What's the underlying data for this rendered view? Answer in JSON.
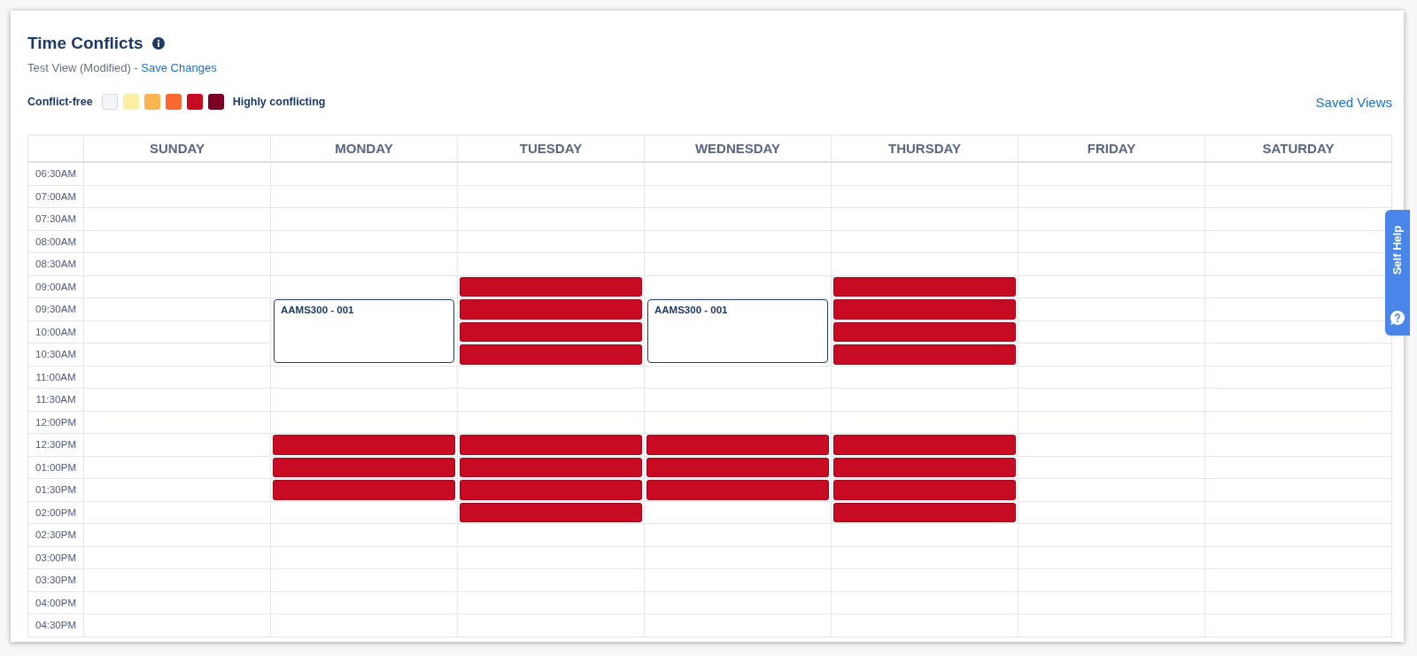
{
  "header": {
    "title": "Time Conflicts",
    "subtitle": "Test View (Modified) - ",
    "save_link": "Save Changes"
  },
  "legend": {
    "low_label": "Conflict-free",
    "high_label": "Highly conflicting",
    "swatches": [
      {
        "color": "#f3f5f9"
      },
      {
        "color": "#fdeea6"
      },
      {
        "color": "#fbb34f"
      },
      {
        "color": "#fa6731"
      },
      {
        "color": "#c80a23"
      },
      {
        "color": "#7b0025"
      }
    ]
  },
  "saved_views": "Saved Views",
  "self_help": "Self Help",
  "calendar": {
    "times": [
      "06:30AM",
      "07:00AM",
      "07:30AM",
      "08:00AM",
      "08:30AM",
      "09:00AM",
      "09:30AM",
      "10:00AM",
      "10:30AM",
      "11:00AM",
      "11:30AM",
      "12:00PM",
      "12:30PM",
      "01:00PM",
      "01:30PM",
      "02:00PM",
      "02:30PM",
      "03:00PM",
      "03:30PM",
      "04:00PM",
      "04:30PM"
    ],
    "days": [
      {
        "name": "SUNDAY",
        "slots": [
          {
            "kind": "empty"
          },
          {
            "kind": "empty"
          },
          {
            "kind": "empty"
          },
          {
            "kind": "empty"
          },
          {
            "kind": "empty"
          },
          {
            "kind": "empty"
          },
          {
            "kind": "empty"
          },
          {
            "kind": "empty"
          },
          {
            "kind": "empty"
          },
          {
            "kind": "empty"
          },
          {
            "kind": "empty"
          },
          {
            "kind": "empty"
          },
          {
            "kind": "empty"
          },
          {
            "kind": "empty"
          },
          {
            "kind": "empty"
          },
          {
            "kind": "empty"
          },
          {
            "kind": "empty"
          },
          {
            "kind": "empty"
          },
          {
            "kind": "empty"
          },
          {
            "kind": "empty"
          },
          {
            "kind": "empty"
          }
        ]
      },
      {
        "name": "MONDAY",
        "slots": [
          {
            "kind": "empty"
          },
          {
            "kind": "empty"
          },
          {
            "kind": "empty"
          },
          {
            "kind": "empty"
          },
          {
            "kind": "empty"
          },
          {
            "kind": "empty"
          },
          {
            "kind": "course",
            "label": "AAMS300 - 001"
          },
          {
            "kind": "course-cont"
          },
          {
            "kind": "course-cont"
          },
          {
            "kind": "empty"
          },
          {
            "kind": "empty"
          },
          {
            "kind": "empty"
          },
          {
            "kind": "conflict",
            "color": "#c80a23"
          },
          {
            "kind": "conflict",
            "color": "#c80a23"
          },
          {
            "kind": "conflict",
            "color": "#c80a23"
          },
          {
            "kind": "empty"
          },
          {
            "kind": "empty"
          },
          {
            "kind": "empty"
          },
          {
            "kind": "empty"
          },
          {
            "kind": "empty"
          },
          {
            "kind": "empty"
          }
        ]
      },
      {
        "name": "TUESDAY",
        "slots": [
          {
            "kind": "empty"
          },
          {
            "kind": "empty"
          },
          {
            "kind": "empty"
          },
          {
            "kind": "empty"
          },
          {
            "kind": "empty"
          },
          {
            "kind": "conflict",
            "color": "#c80a23"
          },
          {
            "kind": "conflict",
            "color": "#c80a23"
          },
          {
            "kind": "conflict",
            "color": "#c80a23"
          },
          {
            "kind": "conflict",
            "color": "#c80a23"
          },
          {
            "kind": "empty"
          },
          {
            "kind": "empty"
          },
          {
            "kind": "empty"
          },
          {
            "kind": "conflict",
            "color": "#c80a23"
          },
          {
            "kind": "conflict",
            "color": "#c80a23"
          },
          {
            "kind": "conflict",
            "color": "#c80a23"
          },
          {
            "kind": "conflict",
            "color": "#c80a23"
          },
          {
            "kind": "empty"
          },
          {
            "kind": "empty"
          },
          {
            "kind": "empty"
          },
          {
            "kind": "empty"
          },
          {
            "kind": "empty"
          }
        ]
      },
      {
        "name": "WEDNESDAY",
        "slots": [
          {
            "kind": "empty"
          },
          {
            "kind": "empty"
          },
          {
            "kind": "empty"
          },
          {
            "kind": "empty"
          },
          {
            "kind": "empty"
          },
          {
            "kind": "empty"
          },
          {
            "kind": "course",
            "label": "AAMS300 - 001"
          },
          {
            "kind": "course-cont"
          },
          {
            "kind": "course-cont"
          },
          {
            "kind": "empty"
          },
          {
            "kind": "empty"
          },
          {
            "kind": "empty"
          },
          {
            "kind": "conflict",
            "color": "#c80a23"
          },
          {
            "kind": "conflict",
            "color": "#c80a23"
          },
          {
            "kind": "conflict",
            "color": "#c80a23"
          },
          {
            "kind": "empty"
          },
          {
            "kind": "empty"
          },
          {
            "kind": "empty"
          },
          {
            "kind": "empty"
          },
          {
            "kind": "empty"
          },
          {
            "kind": "empty"
          }
        ]
      },
      {
        "name": "THURSDAY",
        "slots": [
          {
            "kind": "empty"
          },
          {
            "kind": "empty"
          },
          {
            "kind": "empty"
          },
          {
            "kind": "empty"
          },
          {
            "kind": "empty"
          },
          {
            "kind": "conflict",
            "color": "#c80a23"
          },
          {
            "kind": "conflict",
            "color": "#c80a23"
          },
          {
            "kind": "conflict",
            "color": "#c80a23"
          },
          {
            "kind": "conflict",
            "color": "#c80a23"
          },
          {
            "kind": "empty"
          },
          {
            "kind": "empty"
          },
          {
            "kind": "empty"
          },
          {
            "kind": "conflict",
            "color": "#c80a23"
          },
          {
            "kind": "conflict",
            "color": "#c80a23"
          },
          {
            "kind": "conflict",
            "color": "#c80a23"
          },
          {
            "kind": "conflict",
            "color": "#c80a23"
          },
          {
            "kind": "empty"
          },
          {
            "kind": "empty"
          },
          {
            "kind": "empty"
          },
          {
            "kind": "empty"
          },
          {
            "kind": "empty"
          }
        ]
      },
      {
        "name": "FRIDAY",
        "slots": [
          {
            "kind": "empty"
          },
          {
            "kind": "empty"
          },
          {
            "kind": "empty"
          },
          {
            "kind": "empty"
          },
          {
            "kind": "empty"
          },
          {
            "kind": "empty"
          },
          {
            "kind": "empty"
          },
          {
            "kind": "empty"
          },
          {
            "kind": "empty"
          },
          {
            "kind": "empty"
          },
          {
            "kind": "empty"
          },
          {
            "kind": "empty"
          },
          {
            "kind": "empty"
          },
          {
            "kind": "empty"
          },
          {
            "kind": "empty"
          },
          {
            "kind": "empty"
          },
          {
            "kind": "empty"
          },
          {
            "kind": "empty"
          },
          {
            "kind": "empty"
          },
          {
            "kind": "empty"
          },
          {
            "kind": "empty"
          }
        ]
      },
      {
        "name": "SATURDAY",
        "slots": [
          {
            "kind": "empty"
          },
          {
            "kind": "empty"
          },
          {
            "kind": "empty"
          },
          {
            "kind": "empty"
          },
          {
            "kind": "empty"
          },
          {
            "kind": "empty"
          },
          {
            "kind": "empty"
          },
          {
            "kind": "empty"
          },
          {
            "kind": "empty"
          },
          {
            "kind": "empty"
          },
          {
            "kind": "empty"
          },
          {
            "kind": "empty"
          },
          {
            "kind": "empty"
          },
          {
            "kind": "empty"
          },
          {
            "kind": "empty"
          },
          {
            "kind": "empty"
          },
          {
            "kind": "empty"
          },
          {
            "kind": "empty"
          },
          {
            "kind": "empty"
          },
          {
            "kind": "empty"
          },
          {
            "kind": "empty"
          }
        ]
      }
    ]
  }
}
